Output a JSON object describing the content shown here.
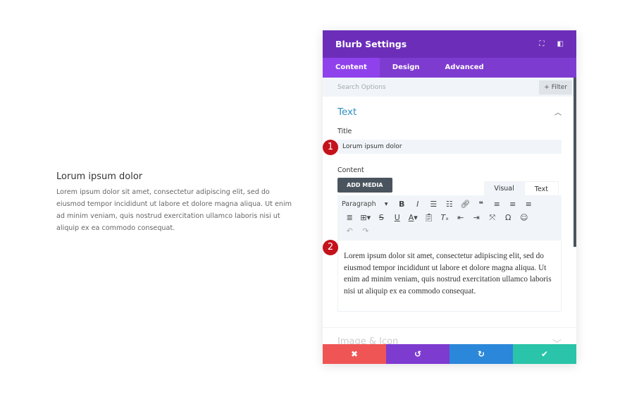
{
  "preview": {
    "title": "Lorum ipsum dolor",
    "body": "Lorem ipsum dolor sit amet, consectetur adipiscing elit, sed do eiusmod tempor incididunt ut labore et dolore magna aliqua. Ut enim ad minim veniam, quis nostrud exercitation ullamco laboris nisi ut aliquip ex ea commodo consequat."
  },
  "panel": {
    "title": "Blurb Settings",
    "tabs": [
      "Content",
      "Design",
      "Advanced"
    ],
    "search_placeholder": "Search Options",
    "filter": "+ Filter",
    "section": "Text",
    "title_label": "Title",
    "title_value": "Lorum ipsum dolor",
    "content_label": "Content",
    "add_media": "ADD MEDIA",
    "visual": "Visual",
    "text": "Text",
    "format": "Paragraph",
    "content_value": "Lorem ipsum dolor sit amet, consectetur adipiscing elit, sed do eiusmod tempor incididunt ut labore et dolore magna aliqua. Ut enim ad minim veniam, quis nostrud exercitation ullamco laboris nisi ut aliquip ex ea commodo consequat.",
    "next_section": "Image & Icon",
    "badges": [
      "1",
      "2"
    ]
  },
  "colors": {
    "header": "#6c2eb9",
    "tabs": "#7e3bd0",
    "cancel": "#ef5555",
    "undo": "#7e3bd0",
    "redo": "#2b87da",
    "save": "#29c4a9"
  }
}
